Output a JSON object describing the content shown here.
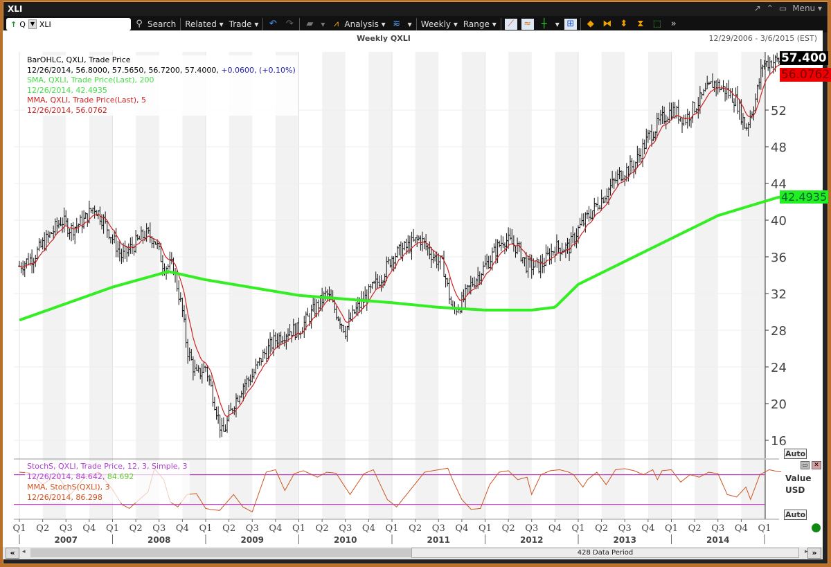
{
  "window": {
    "title": "XLI",
    "controls": [
      "↗",
      "⌃",
      "▭",
      "Menu ▾"
    ]
  },
  "toolbar": {
    "symbol_prefix": "Q",
    "symbol": "XLI",
    "search": "Search",
    "related": "Related ▾",
    "trade": "Trade ▾",
    "analysis": "Analysis ▾",
    "periodicity": "Weekly ▾",
    "range": "Range ▾"
  },
  "chart": {
    "title": "Weekly QXLI",
    "date_range": "12/29/2006 - 3/6/2015 (EST)",
    "last_price_tag": "57.400",
    "mma_tag": "56.0762",
    "sma_tag": "42.4935",
    "auto1": "Auto",
    "auto2": "Auto",
    "value_label": "Value",
    "currency_label": "USD"
  },
  "legend": {
    "l1": "BarOHLC, QXLI, Trade Price",
    "l2a": "12/26/2014, 56.8000, 57.5650, 56.7200, 57.4000,",
    "l2b": " +0.0600, (+0.10%)",
    "l3": "SMA, QXLI, Trade Price(Last),  200",
    "l4": "12/26/2014, 42.4935",
    "l5": "MMA, QXLI, Trade Price(Last),  5",
    "l6": "12/26/2014, 56.0762"
  },
  "stoch_legend": {
    "l1": "StochS, QXLI, Trade Price,  12, 3, Simple, 3",
    "l2a": "12/26/2014, 84.642, ",
    "l2b": "84.692",
    "l3": "MMA, StochS(QXLI),  3",
    "l4": "12/26/2014, 86.298"
  },
  "scrollbar": {
    "label": "428 Data Period"
  },
  "colors": {
    "sma": "#33ee22",
    "mma": "#cc2222",
    "stoch": "#cc5522",
    "bands": "#cc44cc",
    "window_border": "#b8702a"
  },
  "chart_data": {
    "type": "line",
    "title": "Weekly QXLI",
    "ylim": [
      14,
      58
    ],
    "yticks": [
      16,
      20,
      24,
      28,
      32,
      36,
      40,
      44,
      48,
      52
    ],
    "x_start": 2007.0,
    "x_end": 2015.18,
    "quarters": [
      "Q1",
      "Q2",
      "Q3",
      "Q4"
    ],
    "years": [
      "2007",
      "2008",
      "2009",
      "2010",
      "2011",
      "2012",
      "2013",
      "2014"
    ],
    "last_quarter": "Q1",
    "price_close": [
      [
        2007.0,
        35
      ],
      [
        2007.15,
        36
      ],
      [
        2007.3,
        38
      ],
      [
        2007.45,
        40
      ],
      [
        2007.55,
        39
      ],
      [
        2007.7,
        40
      ],
      [
        2007.8,
        41.5
      ],
      [
        2007.9,
        40
      ],
      [
        2008.0,
        38
      ],
      [
        2008.1,
        36
      ],
      [
        2008.2,
        37
      ],
      [
        2008.35,
        38.5
      ],
      [
        2008.45,
        38
      ],
      [
        2008.55,
        35
      ],
      [
        2008.65,
        35
      ],
      [
        2008.75,
        30
      ],
      [
        2008.8,
        26
      ],
      [
        2008.9,
        23
      ],
      [
        2009.0,
        24
      ],
      [
        2009.1,
        20
      ],
      [
        2009.18,
        16.5
      ],
      [
        2009.3,
        20
      ],
      [
        2009.4,
        22
      ],
      [
        2009.5,
        23
      ],
      [
        2009.6,
        25
      ],
      [
        2009.75,
        27
      ],
      [
        2009.9,
        28
      ],
      [
        2010.0,
        28
      ],
      [
        2010.15,
        30
      ],
      [
        2010.3,
        32
      ],
      [
        2010.4,
        30
      ],
      [
        2010.5,
        28
      ],
      [
        2010.6,
        30
      ],
      [
        2010.75,
        32
      ],
      [
        2010.9,
        34
      ],
      [
        2011.0,
        36
      ],
      [
        2011.15,
        37
      ],
      [
        2011.3,
        38
      ],
      [
        2011.45,
        36
      ],
      [
        2011.55,
        35
      ],
      [
        2011.65,
        30
      ],
      [
        2011.75,
        31
      ],
      [
        2011.85,
        33
      ],
      [
        2012.0,
        35
      ],
      [
        2012.2,
        38
      ],
      [
        2012.35,
        37
      ],
      [
        2012.45,
        35
      ],
      [
        2012.6,
        35
      ],
      [
        2012.75,
        37
      ],
      [
        2012.9,
        37
      ],
      [
        2013.0,
        39
      ],
      [
        2013.15,
        41
      ],
      [
        2013.3,
        43
      ],
      [
        2013.45,
        45
      ],
      [
        2013.6,
        46
      ],
      [
        2013.75,
        49
      ],
      [
        2013.9,
        51
      ],
      [
        2014.0,
        52
      ],
      [
        2014.15,
        51
      ],
      [
        2014.3,
        53
      ],
      [
        2014.45,
        55
      ],
      [
        2014.6,
        54
      ],
      [
        2014.7,
        53
      ],
      [
        2014.8,
        50
      ],
      [
        2014.9,
        53
      ],
      [
        2014.98,
        57
      ],
      [
        2015.05,
        57.2
      ],
      [
        2015.15,
        57.4
      ]
    ],
    "sma200": [
      [
        2007.0,
        29.1
      ],
      [
        2008.0,
        32.7
      ],
      [
        2008.6,
        34.4
      ],
      [
        2009.0,
        33.5
      ],
      [
        2010.0,
        31.8
      ],
      [
        2011.0,
        31
      ],
      [
        2011.5,
        30.5
      ],
      [
        2012.0,
        30.2
      ],
      [
        2012.5,
        30.2
      ],
      [
        2012.75,
        30.5
      ],
      [
        2013.0,
        33
      ],
      [
        2013.5,
        35.5
      ],
      [
        2014.0,
        38
      ],
      [
        2014.5,
        40.5
      ],
      [
        2015.15,
        42.5
      ]
    ],
    "stoch_ylim": [
      0,
      100
    ],
    "stoch_bands": [
      80,
      20
    ],
    "stoch": [
      [
        2007.0,
        85
      ],
      [
        2007.1,
        84
      ],
      [
        2007.25,
        60
      ],
      [
        2007.4,
        80
      ],
      [
        2007.55,
        40
      ],
      [
        2007.7,
        75
      ],
      [
        2007.85,
        85
      ],
      [
        2008.0,
        50
      ],
      [
        2008.1,
        20
      ],
      [
        2008.18,
        12
      ],
      [
        2008.3,
        32
      ],
      [
        2008.38,
        45
      ],
      [
        2008.45,
        92
      ],
      [
        2008.55,
        70
      ],
      [
        2008.62,
        25
      ],
      [
        2008.7,
        15
      ],
      [
        2008.8,
        40
      ],
      [
        2008.9,
        42
      ],
      [
        2009.0,
        12
      ],
      [
        2009.05,
        10
      ],
      [
        2009.15,
        8
      ],
      [
        2009.3,
        40
      ],
      [
        2009.4,
        15
      ],
      [
        2009.5,
        5
      ],
      [
        2009.65,
        85
      ],
      [
        2009.75,
        90
      ],
      [
        2009.85,
        48
      ],
      [
        2009.95,
        82
      ],
      [
        2010.05,
        88
      ],
      [
        2010.2,
        75
      ],
      [
        2010.3,
        85
      ],
      [
        2010.4,
        83
      ],
      [
        2010.55,
        40
      ],
      [
        2010.7,
        82
      ],
      [
        2010.8,
        90
      ],
      [
        2010.95,
        30
      ],
      [
        2011.05,
        15
      ],
      [
        2011.2,
        50
      ],
      [
        2011.35,
        85
      ],
      [
        2011.5,
        90
      ],
      [
        2011.6,
        93
      ],
      [
        2011.65,
        70
      ],
      [
        2011.75,
        30
      ],
      [
        2011.85,
        10
      ],
      [
        2011.95,
        12
      ],
      [
        2012.05,
        60
      ],
      [
        2012.15,
        85
      ],
      [
        2012.25,
        88
      ],
      [
        2012.35,
        70
      ],
      [
        2012.45,
        75
      ],
      [
        2012.5,
        40
      ],
      [
        2012.6,
        80
      ],
      [
        2012.7,
        88
      ],
      [
        2012.8,
        90
      ],
      [
        2012.9,
        85
      ],
      [
        2012.95,
        80
      ],
      [
        2013.05,
        55
      ],
      [
        2013.1,
        70
      ],
      [
        2013.2,
        85
      ],
      [
        2013.3,
        60
      ],
      [
        2013.4,
        90
      ],
      [
        2013.5,
        92
      ],
      [
        2013.6,
        88
      ],
      [
        2013.7,
        80
      ],
      [
        2013.8,
        90
      ],
      [
        2013.85,
        70
      ],
      [
        2013.9,
        88
      ],
      [
        2014.0,
        90
      ],
      [
        2014.1,
        65
      ],
      [
        2014.2,
        80
      ],
      [
        2014.3,
        75
      ],
      [
        2014.4,
        85
      ],
      [
        2014.5,
        82
      ],
      [
        2014.6,
        40
      ],
      [
        2014.7,
        35
      ],
      [
        2014.8,
        55
      ],
      [
        2014.85,
        30
      ],
      [
        2014.95,
        80
      ],
      [
        2015.05,
        90
      ],
      [
        2015.15,
        86
      ]
    ]
  }
}
